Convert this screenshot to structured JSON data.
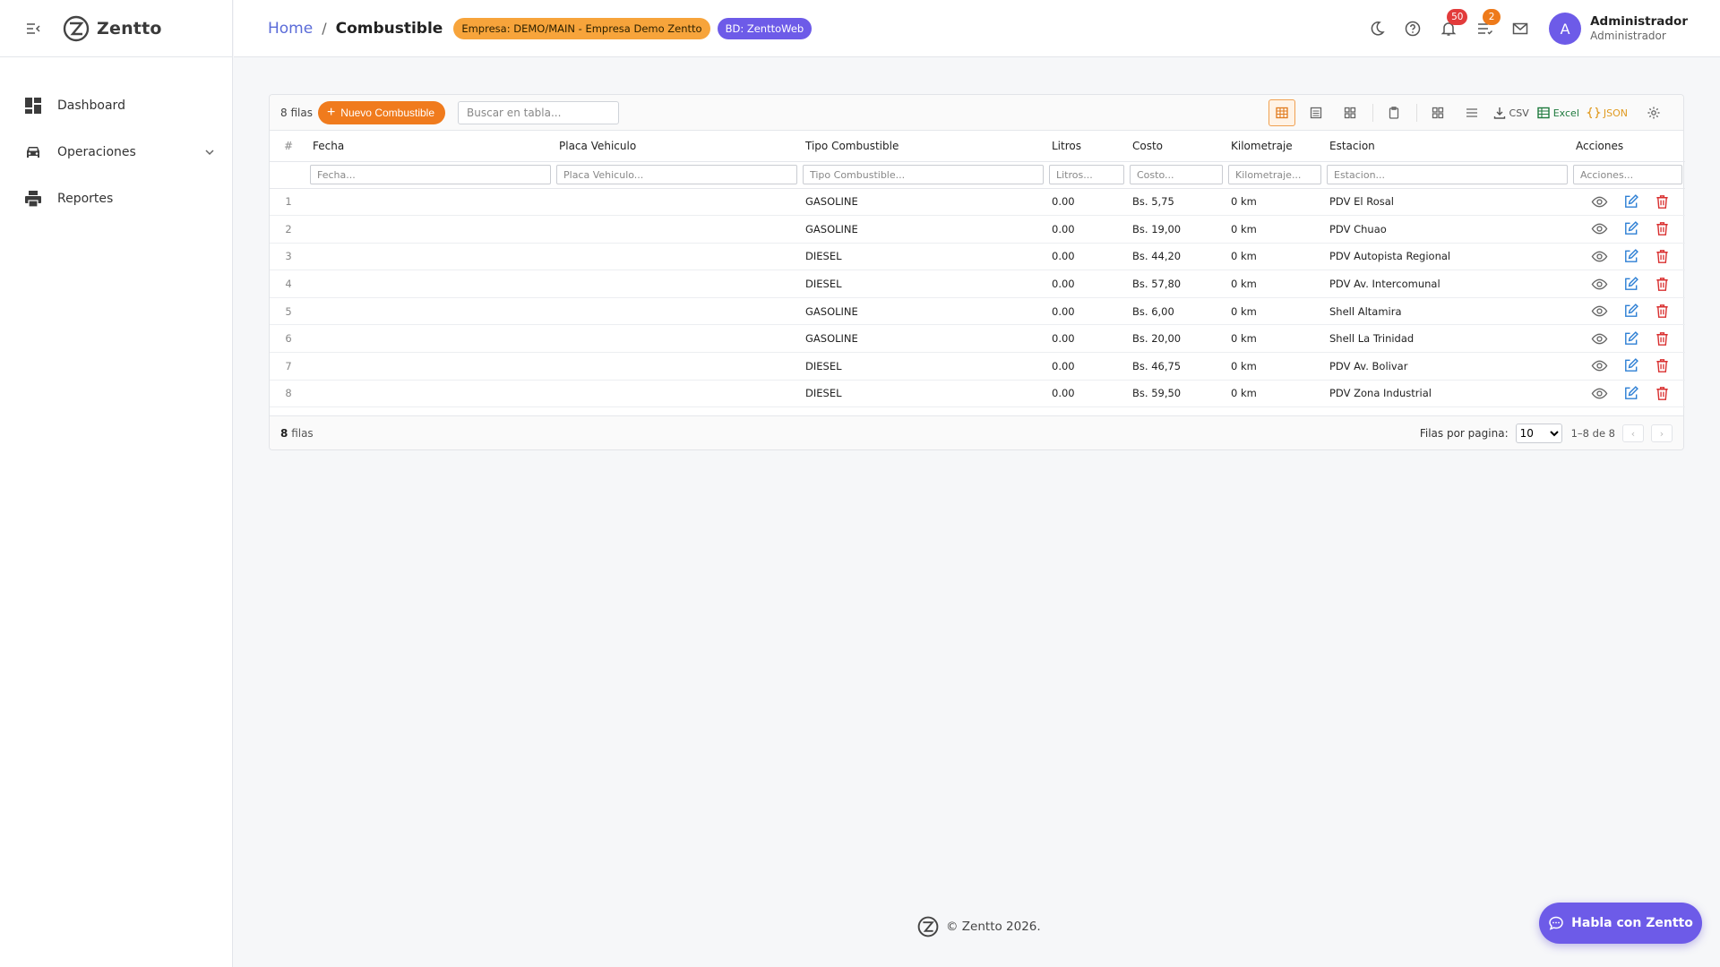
{
  "app": {
    "name": "Zentto"
  },
  "sidebar": {
    "items": [
      {
        "label": "Dashboard",
        "icon": "dashboard-icon"
      },
      {
        "label": "Operaciones",
        "icon": "car-icon"
      },
      {
        "label": "Reportes",
        "icon": "printer-icon"
      }
    ]
  },
  "header": {
    "breadcrumb_home": "Home",
    "breadcrumb_sep": "/",
    "page_title": "Combustible",
    "company_chip": "Empresa: DEMO/MAIN - Empresa Demo Zentto",
    "db_chip": "BD: ZenttoWeb",
    "notifications_count": "50",
    "tasks_count": "2",
    "avatar_letter": "A",
    "user_name": "Administrador",
    "user_role": "Administrador"
  },
  "grid": {
    "row_count_label": "8 filas",
    "new_button_label": "Nuevo Combustible",
    "search_placeholder": "Buscar en tabla...",
    "tools": {
      "csv": "CSV",
      "excel": "Excel",
      "json": "JSON"
    },
    "columns": [
      {
        "key": "num",
        "label": "#"
      },
      {
        "key": "fecha",
        "label": "Fecha",
        "filter": "Fecha..."
      },
      {
        "key": "placa",
        "label": "Placa Vehiculo",
        "filter": "Placa Vehiculo..."
      },
      {
        "key": "tipo",
        "label": "Tipo Combustible",
        "filter": "Tipo Combustible..."
      },
      {
        "key": "litros",
        "label": "Litros",
        "filter": "Litros..."
      },
      {
        "key": "costo",
        "label": "Costo",
        "filter": "Costo..."
      },
      {
        "key": "km",
        "label": "Kilometraje",
        "filter": "Kilometraje..."
      },
      {
        "key": "estacion",
        "label": "Estacion",
        "filter": "Estacion..."
      },
      {
        "key": "acciones",
        "label": "Acciones",
        "filter": "Acciones..."
      }
    ],
    "rows": [
      {
        "num": "1",
        "fecha": "",
        "placa": "",
        "tipo": "GASOLINE",
        "litros": "0.00",
        "costo": "Bs. 5,75",
        "km": "0 km",
        "estacion": "PDV El Rosal"
      },
      {
        "num": "2",
        "fecha": "",
        "placa": "",
        "tipo": "GASOLINE",
        "litros": "0.00",
        "costo": "Bs. 19,00",
        "km": "0 km",
        "estacion": "PDV Chuao"
      },
      {
        "num": "3",
        "fecha": "",
        "placa": "",
        "tipo": "DIESEL",
        "litros": "0.00",
        "costo": "Bs. 44,20",
        "km": "0 km",
        "estacion": "PDV Autopista Regional"
      },
      {
        "num": "4",
        "fecha": "",
        "placa": "",
        "tipo": "DIESEL",
        "litros": "0.00",
        "costo": "Bs. 57,80",
        "km": "0 km",
        "estacion": "PDV Av. Intercomunal"
      },
      {
        "num": "5",
        "fecha": "",
        "placa": "",
        "tipo": "GASOLINE",
        "litros": "0.00",
        "costo": "Bs. 6,00",
        "km": "0 km",
        "estacion": "Shell Altamira"
      },
      {
        "num": "6",
        "fecha": "",
        "placa": "",
        "tipo": "GASOLINE",
        "litros": "0.00",
        "costo": "Bs. 20,00",
        "km": "0 km",
        "estacion": "Shell La Trinidad"
      },
      {
        "num": "7",
        "fecha": "",
        "placa": "",
        "tipo": "DIESEL",
        "litros": "0.00",
        "costo": "Bs. 46,75",
        "km": "0 km",
        "estacion": "PDV Av. Bolivar"
      },
      {
        "num": "8",
        "fecha": "",
        "placa": "",
        "tipo": "DIESEL",
        "litros": "0.00",
        "costo": "Bs. 59,50",
        "km": "0 km",
        "estacion": "PDV Zona Industrial"
      }
    ],
    "footer_count": "8",
    "footer_count_suffix": "filas",
    "rows_per_page_label": "Filas por pagina:",
    "rows_per_page_value": "10",
    "page_range": "1–8 de 8"
  },
  "footer": {
    "copyright": "© Zentto 2026."
  },
  "chat": {
    "label": "Habla con Zentto"
  },
  "colors": {
    "accent": "#f07b1d",
    "brand": "#6d5be8",
    "link": "#5a6bd8",
    "delete": "#d93030",
    "edit": "#2d7fd4"
  }
}
